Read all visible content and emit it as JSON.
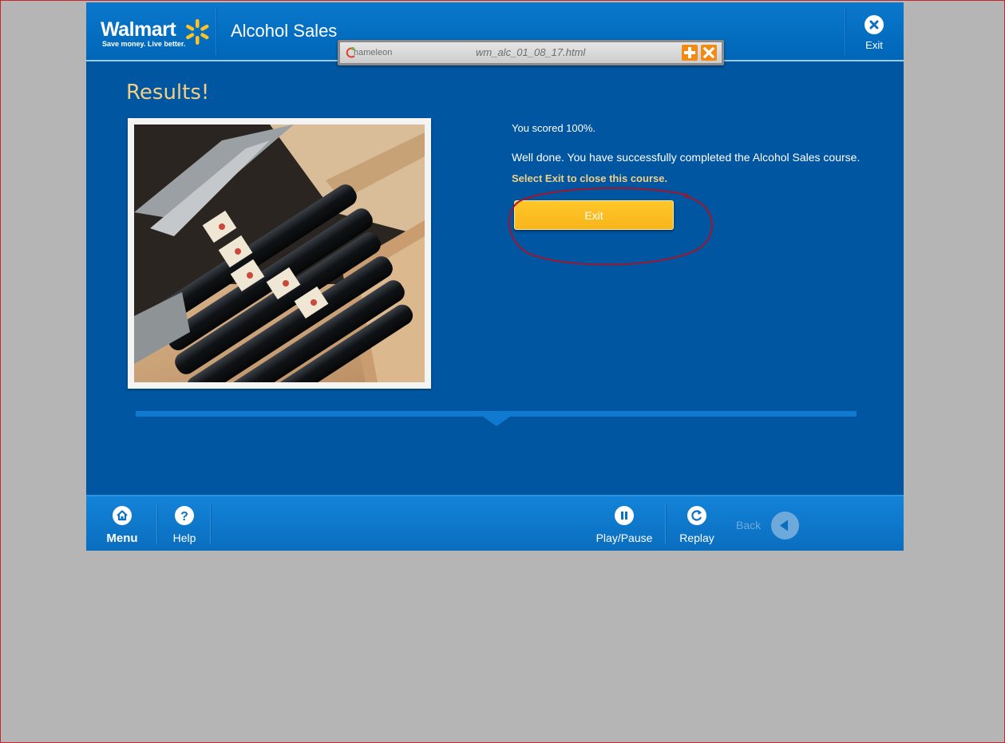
{
  "header": {
    "logo_text": "Walmart",
    "logo_tagline": "Save money. Live better.",
    "course_title": "Alcohol Sales",
    "exit_label": "Exit"
  },
  "chameleon_bar": {
    "logo_text": "hameleon",
    "filename": "wm_alc_01_08_17.html"
  },
  "content": {
    "heading": "Results!",
    "score_text": "You scored 100%.",
    "completion_text": "Well done.  You have successfully completed the Alcohol Sales course.",
    "instruction_text": "Select Exit to close this course.",
    "exit_button_label": "Exit",
    "image_subject": "wine bottles in wooden crate"
  },
  "footer": {
    "menu_label": "Menu",
    "help_label": "Help",
    "play_pause_label": "Play/Pause",
    "replay_label": "Replay",
    "back_label": "Back"
  },
  "colors": {
    "brand_blue": "#0056a0",
    "header_blue": "#0a78cc",
    "accent_gold": "#f2cf84",
    "button_yellow": "#ffc62a",
    "spark_yellow": "#ffc220",
    "annotation_red": "#c8262a"
  }
}
